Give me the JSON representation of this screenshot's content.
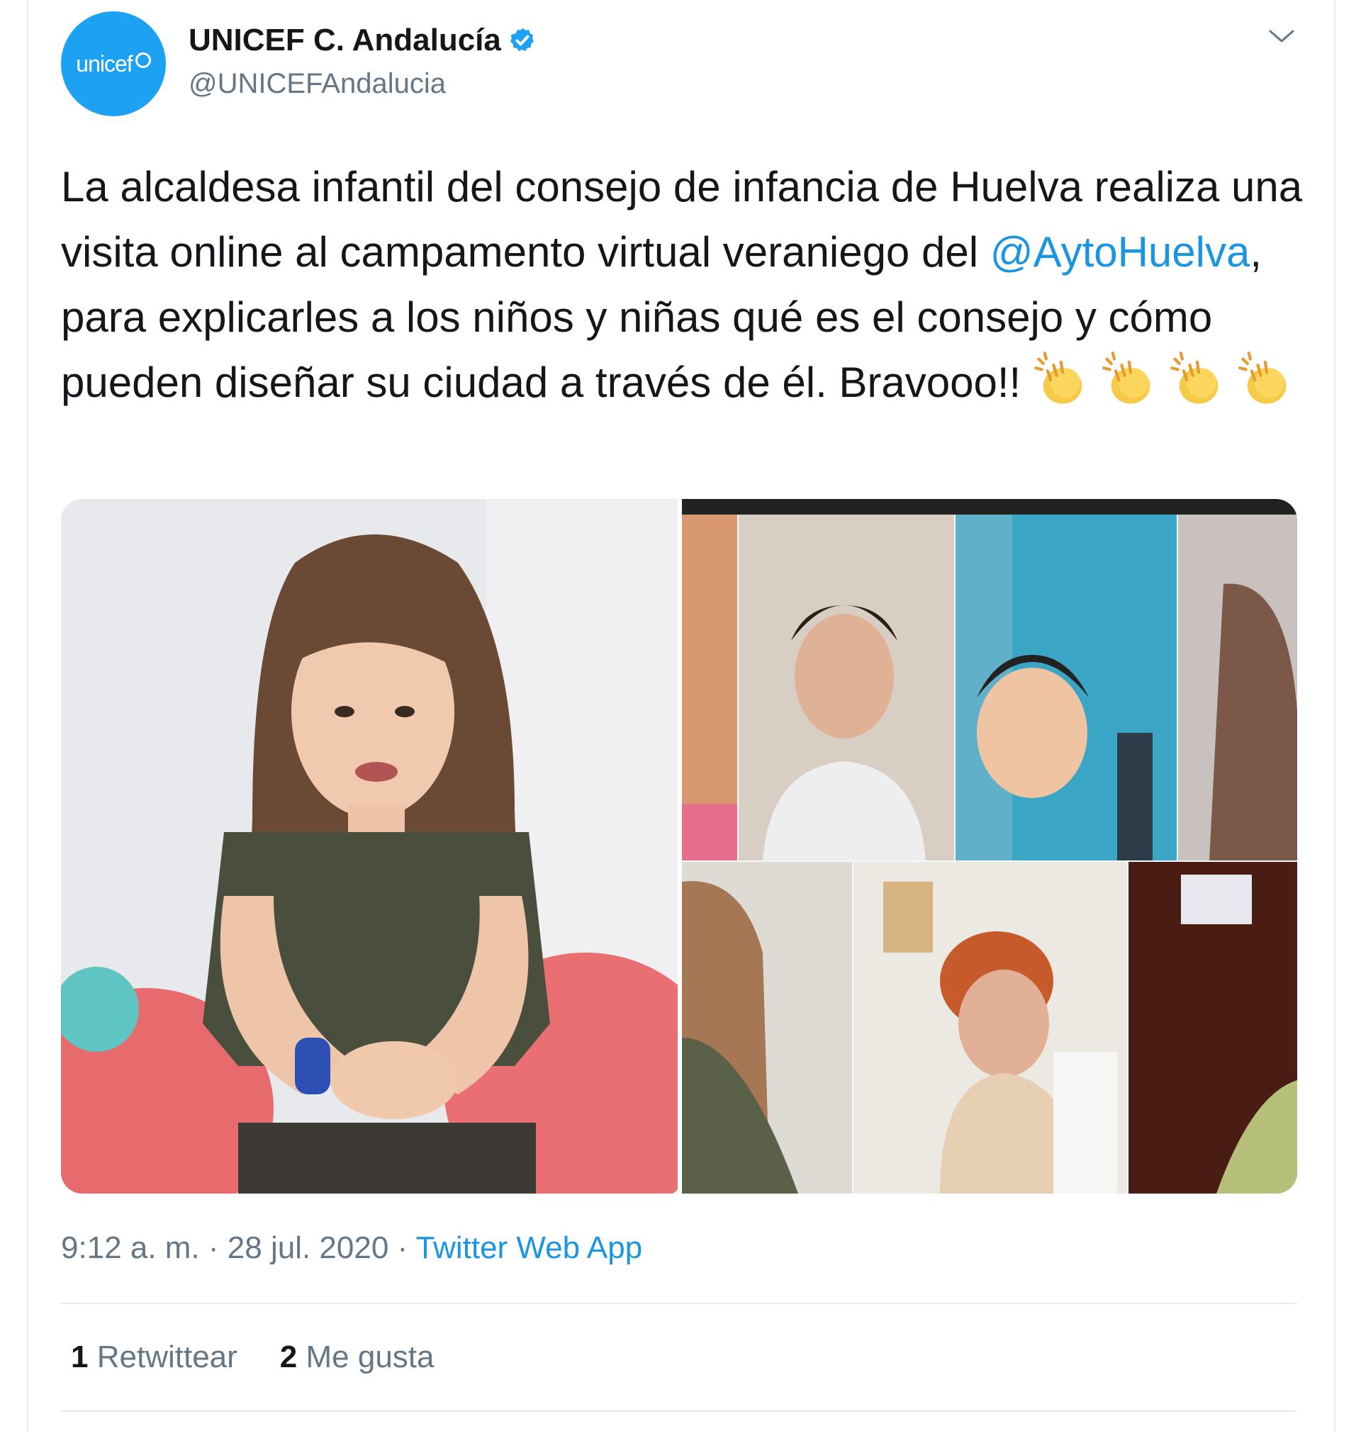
{
  "tweet": {
    "display_name": "UNICEF C. Andalucía",
    "handle": "@UNICEFAndalucia",
    "avatar_text": "unicef",
    "verified": true,
    "text_part1": "La alcaldesa infantil del consejo de infancia de Huelva realiza una visita online al campamento virtual veraniego del ",
    "mention": "@AytoHuelva",
    "text_part2": ", para explicarles a los niños y niñas qué es el consejo y cómo pueden diseñar su ciudad a través de él. Bravooo!! ",
    "emoji": [
      "clapping-hands",
      "clapping-hands",
      "clapping-hands",
      "clapping-hands"
    ],
    "time": "9:12 a. m.",
    "date": "28 jul. 2020",
    "separator": " · ",
    "source_app": "Twitter Web App",
    "retweet_count": "1",
    "retweet_label": "Retwittear",
    "like_count": "2",
    "like_label": "Me gusta"
  },
  "icons": {
    "verified": "verified-badge-icon",
    "menu": "chevron-down-icon",
    "avatar": "unicef-logo"
  },
  "colors": {
    "brand_blue": "#1da1f2",
    "link_blue": "#1b95e0",
    "text": "#14171a",
    "muted": "#657786",
    "divider": "#e6ecf0"
  }
}
